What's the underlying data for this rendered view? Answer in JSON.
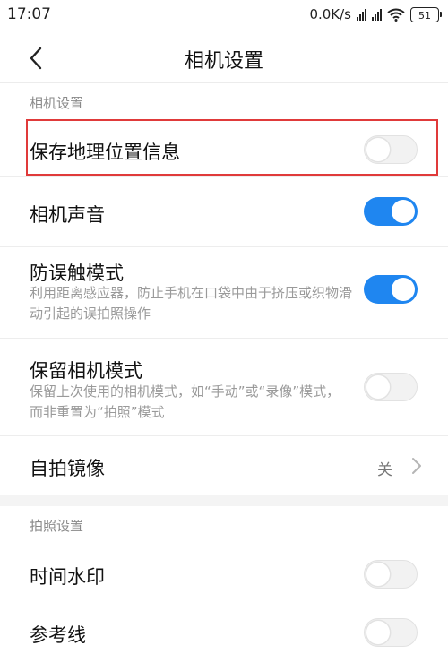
{
  "status_bar": {
    "time": "17:07",
    "speed": "0.0K/s",
    "battery": "51"
  },
  "header": {
    "title": "相机设置",
    "back_icon": "chevron-left-icon"
  },
  "sections": {
    "camera": {
      "label": "相机设置",
      "items": [
        {
          "title": "保存地理位置信息",
          "toggle": "off"
        },
        {
          "title": "相机声音",
          "toggle": "on"
        },
        {
          "title": "防误触模式",
          "desc": "利用距离感应器，防止手机在口袋中由于挤压或织物滑动引起的误拍照操作",
          "toggle": "on"
        },
        {
          "title": "保留相机模式",
          "desc": "保留上次使用的相机模式，如“手动”或“录像”模式，而非重置为“拍照”模式",
          "toggle": "off"
        },
        {
          "title": "自拍镜像",
          "value": "关"
        }
      ]
    },
    "photo": {
      "label": "拍照设置",
      "items": [
        {
          "title": "时间水印",
          "toggle": "off"
        },
        {
          "title": "参考线",
          "toggle": "off"
        }
      ]
    }
  },
  "colors": {
    "accent": "#1f86f0",
    "highlight_border": "#e03a3a"
  }
}
